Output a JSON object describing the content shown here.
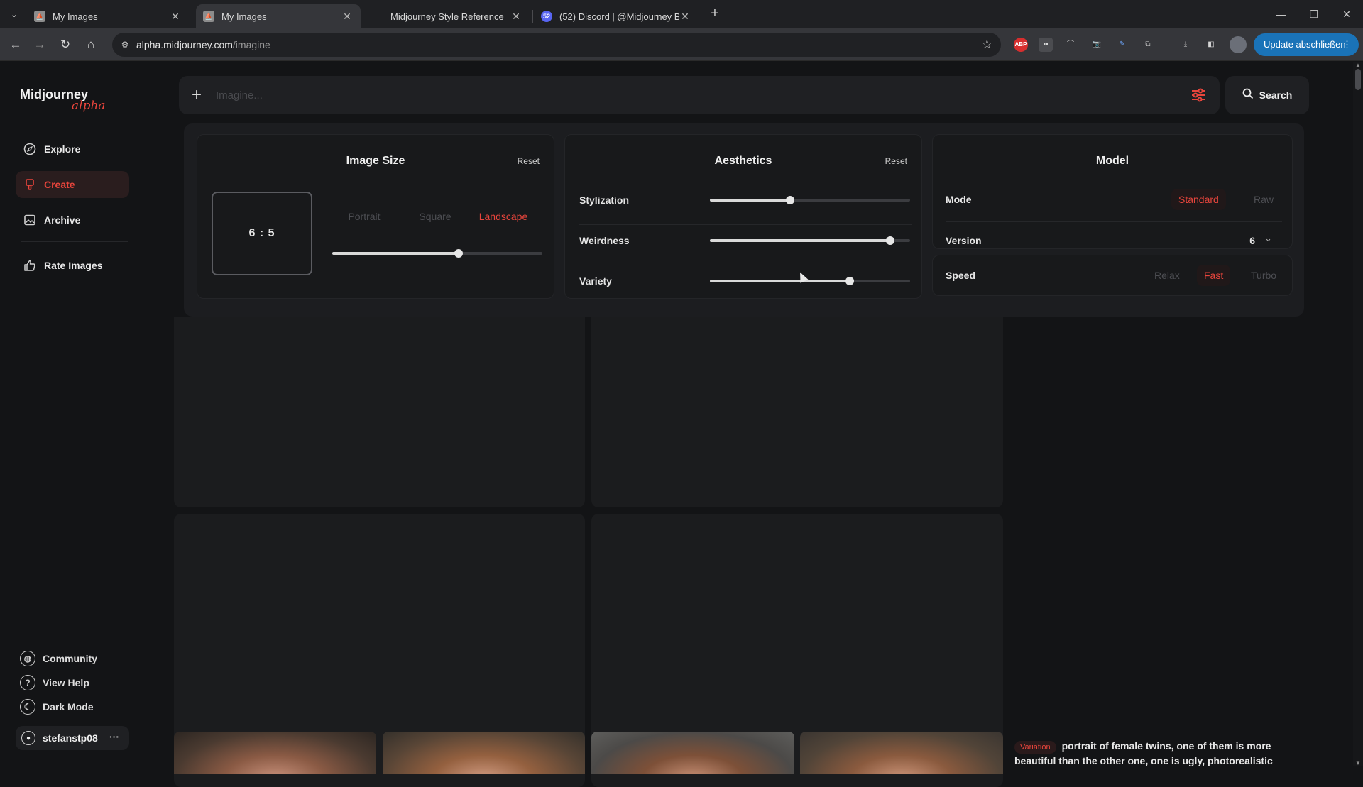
{
  "browser": {
    "tabs": [
      {
        "title": "My Images",
        "active": false
      },
      {
        "title": "My Images",
        "active": true
      },
      {
        "title": "Midjourney Style Reference",
        "active": false
      },
      {
        "title": "(52) Discord | @Midjourney Bot",
        "active": false
      }
    ],
    "url_host": "alpha.midjourney.com",
    "url_path": "/imagine",
    "update_button": "Update abschließen"
  },
  "sidebar": {
    "logo": "Midjourney",
    "logo_sub": "alpha",
    "nav": [
      {
        "label": "Explore",
        "icon": "compass-icon"
      },
      {
        "label": "Create",
        "icon": "brush-icon",
        "active": true
      },
      {
        "label": "Archive",
        "icon": "image-icon"
      },
      {
        "label": "Rate Images",
        "icon": "thumbs-up-icon"
      }
    ],
    "bottom": [
      {
        "label": "Community",
        "icon": "globe-icon"
      },
      {
        "label": "View Help",
        "icon": "help-icon"
      },
      {
        "label": "Dark Mode",
        "icon": "moon-icon"
      }
    ],
    "user": "stefanstp08"
  },
  "prompt": {
    "placeholder": "Imagine...",
    "search_label": "Search"
  },
  "settings": {
    "image_size": {
      "title": "Image Size",
      "reset": "Reset",
      "ratio": "6 : 5",
      "orientations": [
        "Portrait",
        "Square",
        "Landscape"
      ],
      "selected": "Landscape",
      "slider_value": 0.6
    },
    "aesthetics": {
      "title": "Aesthetics",
      "reset": "Reset",
      "sliders": [
        {
          "label": "Stylization",
          "value": 0.4
        },
        {
          "label": "Weirdness",
          "value": 0.9
        },
        {
          "label": "Variety",
          "value": 0.7
        }
      ]
    },
    "model": {
      "title": "Model",
      "mode_label": "Mode",
      "modes": [
        "Standard",
        "Raw"
      ],
      "mode_selected": "Standard",
      "version_label": "Version",
      "version_value": "6",
      "speed_label": "Speed",
      "speeds": [
        "Relax",
        "Fast",
        "Turbo"
      ],
      "speed_selected": "Fast"
    }
  },
  "feed": {
    "badge": "Variation",
    "caption": "portrait of female twins, one of them is more beautiful than the other one, one is ugly, photorealistic"
  },
  "colors": {
    "accent": "#e8453c",
    "background": "#131416",
    "panel": "#1c1d20"
  }
}
